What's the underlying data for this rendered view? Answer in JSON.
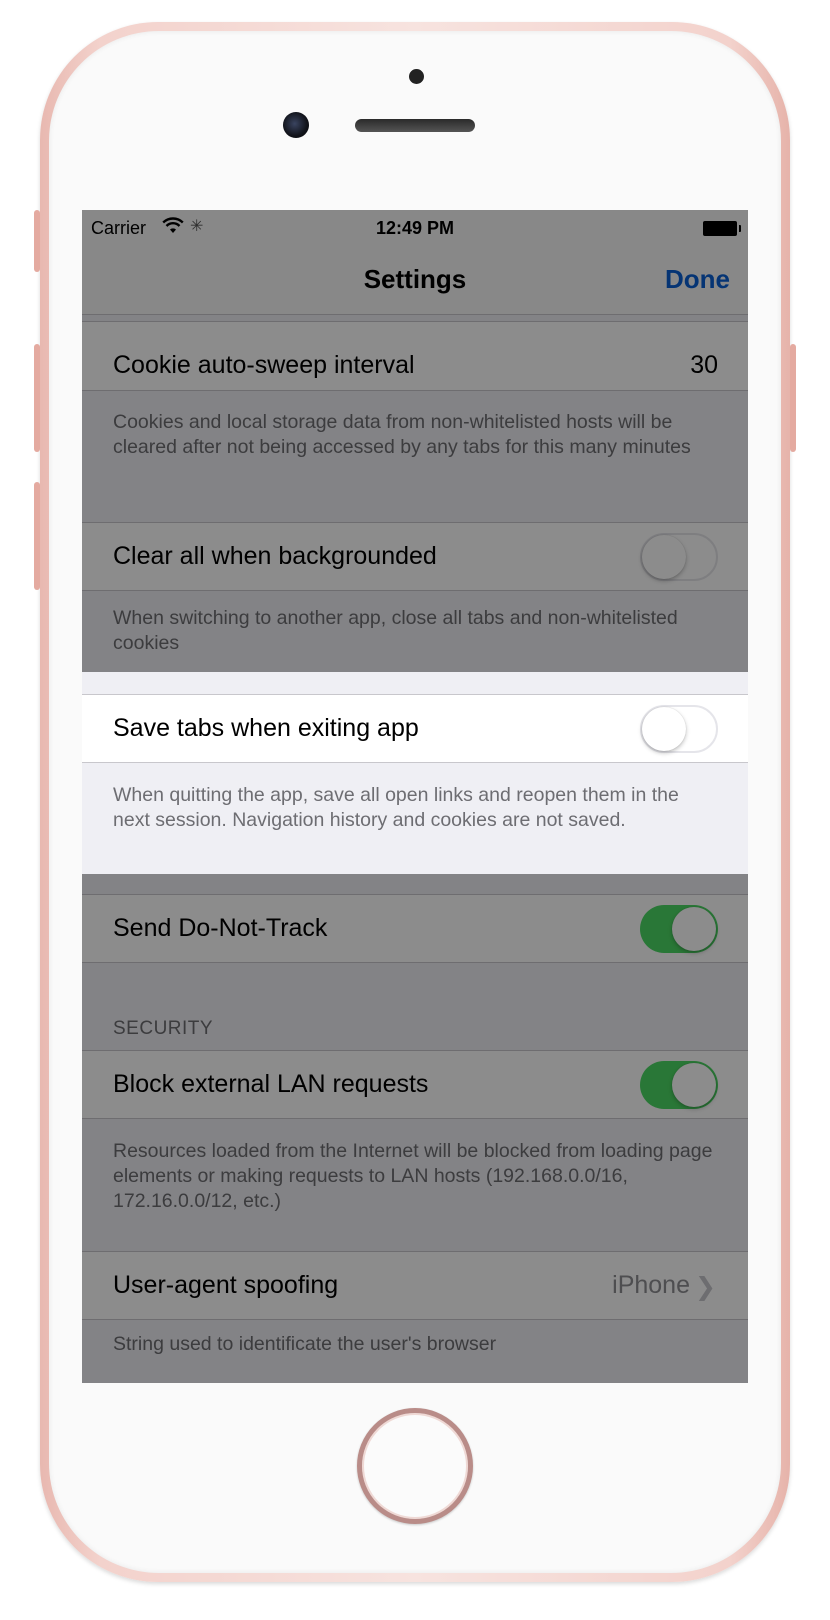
{
  "status_bar": {
    "carrier": "Carrier",
    "time": "12:49 PM"
  },
  "nav": {
    "title": "Settings",
    "done_label": "Done"
  },
  "settings": {
    "cookie_sweep": {
      "label": "Cookie auto-sweep interval",
      "value": "30",
      "footer": "Cookies and local storage data from non-whitelisted hosts will be cleared after not being accessed by any tabs for this many minutes"
    },
    "clear_background": {
      "label": "Clear all when backgrounded",
      "enabled": false,
      "footer": "When switching to another app, close all tabs and non-whitelisted cookies"
    },
    "save_tabs": {
      "label": "Save tabs when exiting app",
      "enabled": false,
      "footer": "When quitting the app, save all open links and reopen them in the next session. Navigation history and cookies are not saved."
    },
    "do_not_track": {
      "label": "Send Do-Not-Track",
      "enabled": true
    },
    "security_header": "SECURITY",
    "block_lan": {
      "label": "Block external LAN requests",
      "enabled": true,
      "footer": "Resources loaded from the Internet will be blocked from loading page elements or making requests to LAN hosts (192.168.0.0/16, 172.16.0.0/12, etc.)"
    },
    "user_agent": {
      "label": "User-agent spoofing",
      "value": "iPhone",
      "footer_partial": "String used to identificate the user's browser"
    }
  },
  "colors": {
    "accent": "#0a60d4",
    "toggle_on": "#4cd964",
    "overlay": "rgba(0,0,0,0.45)"
  },
  "icons": [
    "wifi-icon",
    "activity-spinner-icon",
    "battery-icon",
    "chevron-right-icon"
  ]
}
